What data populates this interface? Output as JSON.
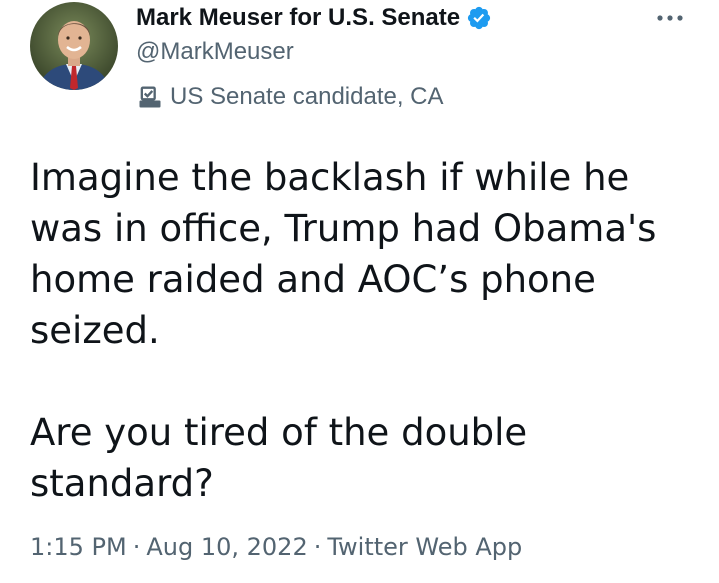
{
  "author": {
    "display_name": "Mark Meuser for U.S. Senate",
    "handle": "@MarkMeuser",
    "label": "US Senate candidate, CA",
    "verified": true
  },
  "icons": {
    "verified": "verified-badge-icon",
    "label": "ballot-box-icon",
    "more": "more-dots-icon"
  },
  "colors": {
    "text_primary": "#0f1419",
    "text_secondary": "#536471",
    "verified_blue": "#1d9bf0",
    "background": "#ffffff"
  },
  "tweet": {
    "paragraph_1": "Imagine the backlash if while he was in office, Trump had Obama's home raided and AOC’s phone seized.",
    "paragraph_2": "Are you tired of the double standard?"
  },
  "meta": {
    "time": "1:15 PM",
    "separator": "·",
    "date": "Aug 10, 2022",
    "source": "Twitter Web App"
  }
}
